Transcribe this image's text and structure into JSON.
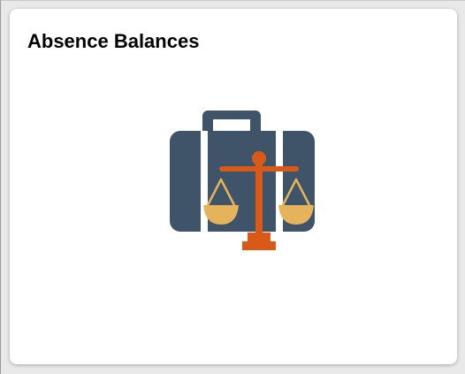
{
  "tile": {
    "title": "Absence Balances",
    "icon": "briefcase-scales-icon"
  },
  "colors": {
    "background": "#e9e9e9",
    "tile": "#ffffff",
    "briefcase": "#3f5468",
    "scale_beam": "#d85a16",
    "scale_pans": "#e5b35c"
  }
}
